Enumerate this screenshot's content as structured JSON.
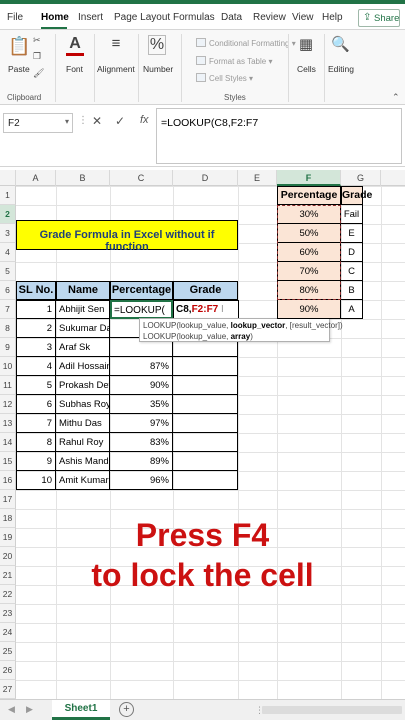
{
  "ribbon_tabs": [
    "File",
    "Home",
    "Insert",
    "Page Layout",
    "Formulas",
    "Data",
    "Review",
    "View",
    "Help"
  ],
  "share_label": "Share",
  "ribbon": {
    "paste": "Paste",
    "clipboard": "Clipboard",
    "font": "Font",
    "alignment": "Alignment",
    "number_icon": "%",
    "number": "Number",
    "conditional_formatting": "Conditional Formatting",
    "format_as_table": "Format as Table",
    "cell_styles": "Cell Styles",
    "styles": "Styles",
    "cells": "Cells",
    "editing": "Editing"
  },
  "formula_bar": {
    "name_box": "F2",
    "cancel": "✕",
    "enter": "✓",
    "fx": "fx",
    "formula": "=LOOKUP(C8,F2:F7"
  },
  "columns": [
    "A",
    "B",
    "C",
    "D",
    "E",
    "F",
    "G"
  ],
  "rows": [
    "1",
    "2",
    "3",
    "4",
    "5",
    "6",
    "7",
    "8",
    "9",
    "10",
    "11",
    "12",
    "13",
    "14",
    "15",
    "16",
    "17",
    "18",
    "19",
    "20",
    "21",
    "22",
    "23",
    "24",
    "25",
    "26",
    "27"
  ],
  "title_box": "Grade Formula in Excel without if function",
  "table_headers": {
    "sl": "SL No.",
    "name": "Name",
    "percentage": "Percentage",
    "grade": "Grade"
  },
  "students": [
    {
      "sl": "1",
      "name": "Abhijit Sen",
      "pct": ""
    },
    {
      "sl": "2",
      "name": "Sukumar Das",
      "pct": ""
    },
    {
      "sl": "3",
      "name": "Araf Sk",
      "pct": ""
    },
    {
      "sl": "4",
      "name": "Adil Hossain",
      "pct": "87%"
    },
    {
      "sl": "5",
      "name": "Prokash Dey",
      "pct": "90%"
    },
    {
      "sl": "6",
      "name": "Subhas Roy",
      "pct": "35%"
    },
    {
      "sl": "7",
      "name": "Mithu Das",
      "pct": "97%"
    },
    {
      "sl": "8",
      "name": "Rahul Roy",
      "pct": "83%"
    },
    {
      "sl": "9",
      "name": "Ashis Mandal",
      "pct": "89%"
    },
    {
      "sl": "10",
      "name": "Amit Kumar",
      "pct": "96%"
    }
  ],
  "editing_cell": {
    "prefix": "=LOOKUP(",
    "ref1": "C8,",
    "ref2": "F2:F7"
  },
  "lookup_table": {
    "header_pct": "Percentage",
    "header_grade": "Grade",
    "rows": [
      {
        "pct": "30%",
        "grade": "Fail"
      },
      {
        "pct": "50%",
        "grade": "E"
      },
      {
        "pct": "60%",
        "grade": "D"
      },
      {
        "pct": "70%",
        "grade": "C"
      },
      {
        "pct": "80%",
        "grade": "B"
      },
      {
        "pct": "90%",
        "grade": "A"
      }
    ]
  },
  "tooltip": {
    "line1_prefix": "LOOKUP(lookup_value, ",
    "line1_bold": "lookup_vector",
    "line1_suffix": ", [result_vector])",
    "line2_prefix": "LOOKUP(lookup_value, ",
    "line2_bold": "array",
    "line2_suffix": ")"
  },
  "overlay": {
    "line1": "Press F4",
    "line2": "to lock the cell"
  },
  "sheet_tab": "Sheet1",
  "add_sheet": "+",
  "colors": {
    "excel_green": "#217346",
    "header_blue": "#bdd7ee",
    "title_yellow": "#ffff00",
    "lookup_peach": "#fbe5d6",
    "overlay_red": "#cc1111"
  }
}
